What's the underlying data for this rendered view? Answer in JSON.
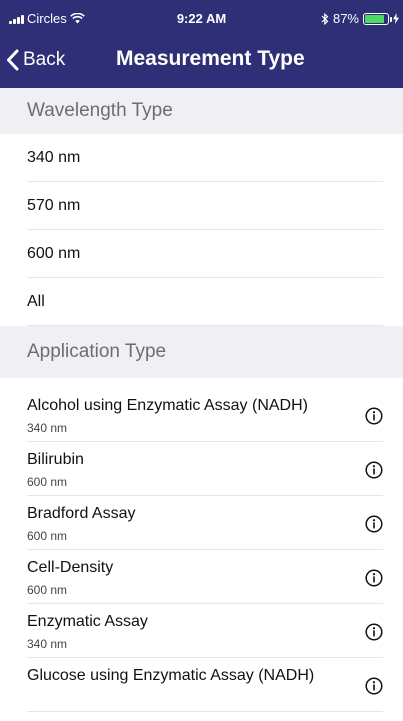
{
  "status_bar": {
    "carrier": "Circles",
    "time": "9:22 AM",
    "battery": "87%",
    "battery_level": 0.87
  },
  "nav": {
    "back_label": "Back",
    "title": "Measurement Type"
  },
  "sections": {
    "wavelength_header": "Wavelength Type",
    "application_header": "Application Type"
  },
  "wavelengths": [
    "340 nm",
    "570 nm",
    "600 nm",
    "All"
  ],
  "applications": [
    {
      "name": "Alcohol using Enzymatic Assay (NADH)",
      "wavelength": "340 nm"
    },
    {
      "name": "Bilirubin",
      "wavelength": "600 nm"
    },
    {
      "name": "Bradford Assay",
      "wavelength": "600 nm"
    },
    {
      "name": "Cell-Density",
      "wavelength": "600 nm"
    },
    {
      "name": "Enzymatic Assay",
      "wavelength": "340 nm"
    },
    {
      "name": "Glucose using Enzymatic Assay (NADH)",
      "wavelength": ""
    }
  ],
  "colors": {
    "nav_background": "#2e2f76",
    "section_background": "#efeff4",
    "battery": "#4cd964"
  },
  "icons": {
    "back": "chevron-left-icon",
    "info": "info-circle-icon",
    "wifi": "wifi-icon",
    "bluetooth": "bluetooth-icon",
    "battery": "battery-icon",
    "charging": "bolt-icon"
  }
}
